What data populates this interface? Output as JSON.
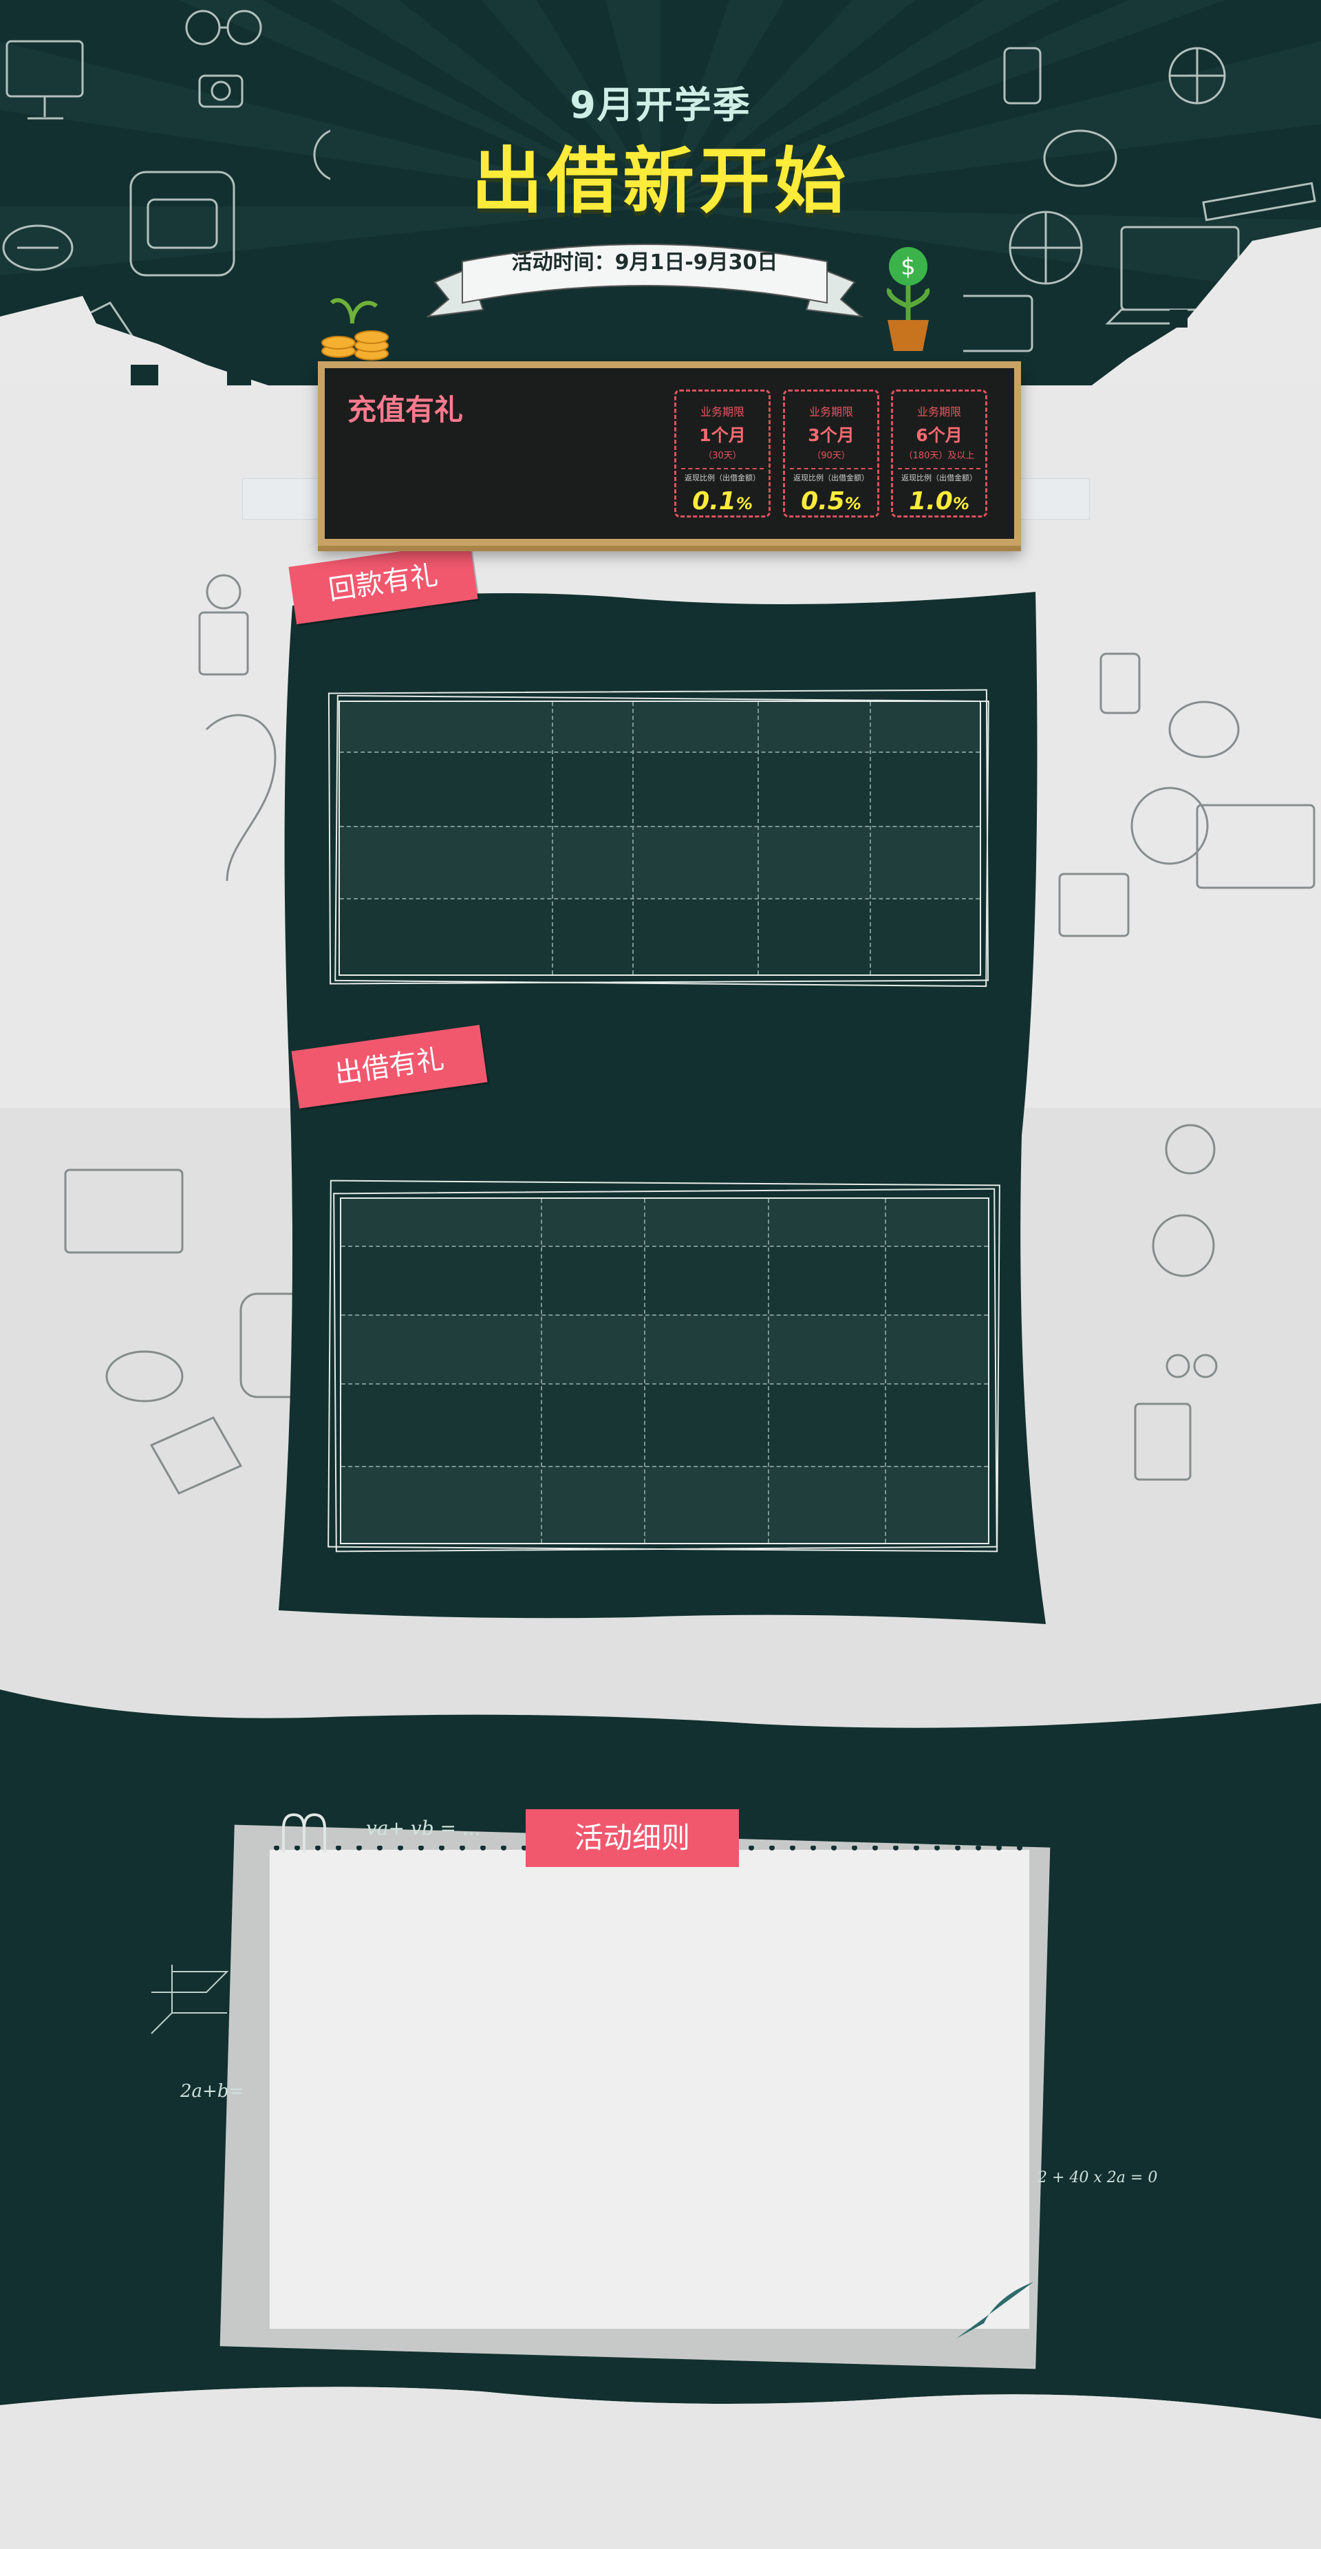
{
  "hero": {
    "subtitle": "9月开学季",
    "title": "出借新开始",
    "activity_time": "活动时间：9月1日-9月30日"
  },
  "recharge": {
    "title": "充值有礼",
    "cards": [
      {
        "label": "业务期限",
        "period": "1个月",
        "days": "（30天）",
        "rate_label": "返现比例（出借金额）",
        "rate": "0.1",
        "unit": "%"
      },
      {
        "label": "业务期限",
        "period": "3个月",
        "days": "（90天）",
        "rate_label": "返现比例（出借金额）",
        "rate": "0.5",
        "unit": "%"
      },
      {
        "label": "业务期限",
        "period": "6个月",
        "days": "（180天）及以上",
        "rate_label": "返现比例（出借金额）",
        "rate": "1.0",
        "unit": "%"
      }
    ]
  },
  "sections": {
    "repay_tag": "回款有礼",
    "lend_tag": "出借有礼",
    "rules_tag": "活动细则"
  },
  "formulas": {
    "f1": "va+ vb = ...",
    "f2": "2a+b=",
    "f3": "2 + 40 x 2a = 0"
  },
  "colors": {
    "dark_green": "#12302f",
    "pink_tag": "#f1586e",
    "yellow_title": "#ffec3a",
    "board_frame": "#c9a366"
  }
}
